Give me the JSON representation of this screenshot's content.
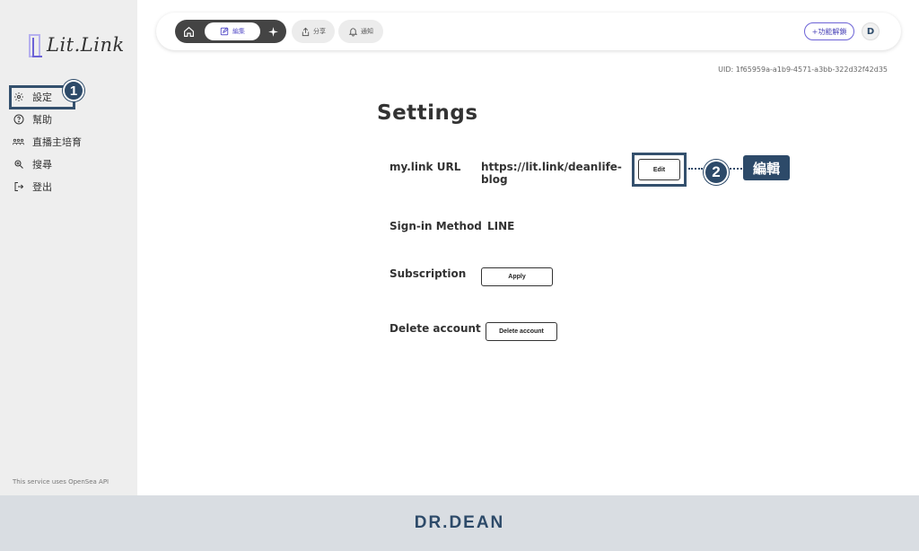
{
  "app": {
    "logo_text": "Lit.Link"
  },
  "sidebar": {
    "items": [
      {
        "label": "設定",
        "icon": "gear-icon"
      },
      {
        "label": "幫助",
        "icon": "help-icon"
      },
      {
        "label": "直播主培育",
        "icon": "people-icon"
      },
      {
        "label": "搜尋",
        "icon": "search-icon"
      },
      {
        "label": "登出",
        "icon": "logout-icon"
      }
    ],
    "footer_note": "This service uses OpenSea API"
  },
  "topbar": {
    "edit_label": "編集",
    "share_label": "分享",
    "notify_label": "通知",
    "unlock_label": "+功能解鎖",
    "avatar_glyph": "D"
  },
  "uid": "UID: 1f65959a-a1b9-4571-a3bb-322d32f42d35",
  "settings": {
    "title": "Settings",
    "url_label": "my.link URL",
    "url_value_line1": "https://lit.link/deanlife-",
    "url_value_line2": "blog",
    "edit_button": "Edit",
    "signin_label": "Sign-in Method",
    "signin_value": "LINE",
    "subscription_label": "Subscription",
    "apply_button": "Apply",
    "delete_label": "Delete account",
    "delete_button": "Delete account"
  },
  "annotations": {
    "step1": "1",
    "step2": "2",
    "callout": "編輯"
  },
  "footer": {
    "brand": "DR.DEAN"
  },
  "colors": {
    "accent": "#6c63d6",
    "annotation": "#2d4a69",
    "sidebar_bg": "#eeeeee",
    "footer_bg": "#d9dde2"
  }
}
